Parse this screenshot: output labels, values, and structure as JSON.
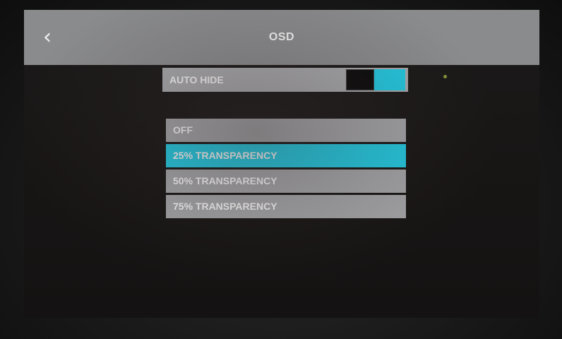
{
  "header": {
    "title": "OSD",
    "back_icon": "chevron-left-icon"
  },
  "auto_hide": {
    "label": "AUTO HIDE",
    "enabled": true
  },
  "transparency_options": [
    {
      "label": "OFF",
      "selected": false
    },
    {
      "label": "25% TRANSPARENCY",
      "selected": true
    },
    {
      "label": "50% TRANSPARENCY",
      "selected": false
    },
    {
      "label": "75% TRANSPARENCY",
      "selected": false
    }
  ],
  "colors": {
    "accent": "#22c8e0",
    "header_bg": "#8a8b8d",
    "row_bg": "#a2a3a6"
  }
}
